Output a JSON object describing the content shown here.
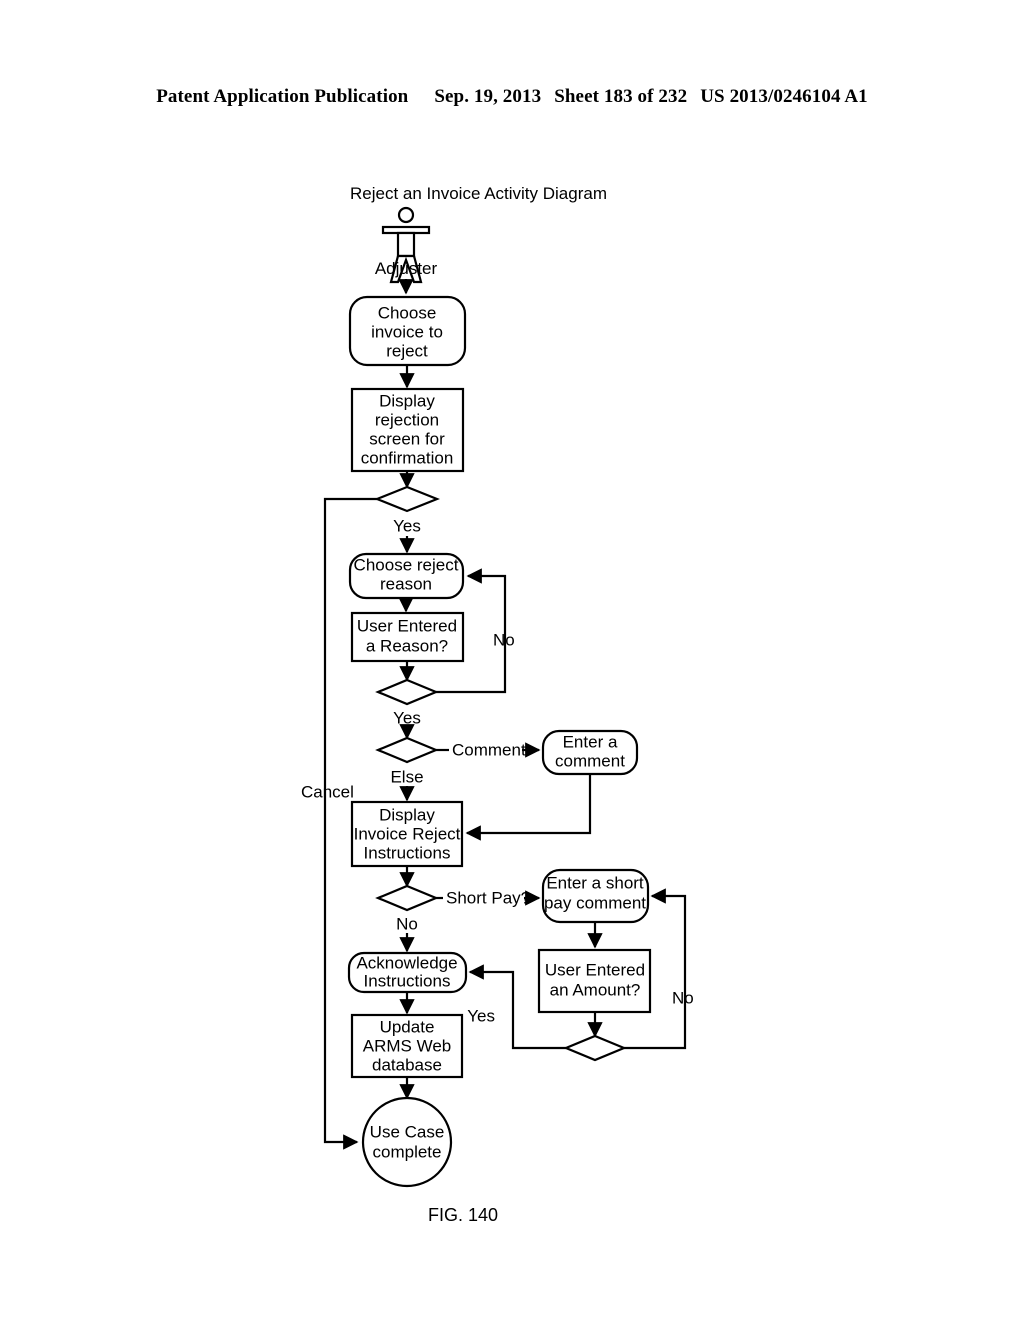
{
  "header": {
    "publication": "Patent Application Publication",
    "date": "Sep. 19, 2013",
    "sheet": "Sheet 183 of 232",
    "patent_number": "US 2013/0246104 A1"
  },
  "figure": {
    "caption": "FIG. 140",
    "title": "Reject an Invoice Activity Diagram",
    "actor": "Adjuster"
  },
  "nodes": {
    "choose_invoice": "Choose invoice to reject",
    "choose_invoice_l1": "Choose",
    "choose_invoice_l2": "invoice to",
    "choose_invoice_l3": "reject",
    "display_rejection_l1": "Display",
    "display_rejection_l2": "rejection",
    "display_rejection_l3": "screen for",
    "display_rejection_l4": "confirmation",
    "choose_reason_l1": "Choose reject",
    "choose_reason_l2": "reason",
    "user_reason_l1": "User Entered",
    "user_reason_l2": "a Reason?",
    "enter_comment_l1": "Enter a",
    "enter_comment_l2": "comment",
    "display_instructions_l1": "Display",
    "display_instructions_l2": "Invoice Reject",
    "display_instructions_l3": "Instructions",
    "short_pay_comment_l1": "Enter a short",
    "short_pay_comment_l2": "pay comment",
    "user_amount_l1": "User Entered",
    "user_amount_l2": "an Amount?",
    "acknowledge_l1": "Acknowledge",
    "acknowledge_l2": "Instructions",
    "update_db_l1": "Update",
    "update_db_l2": "ARMS Web",
    "update_db_l3": "database",
    "use_case_complete_l1": "Use Case",
    "use_case_complete_l2": "complete"
  },
  "edge_labels": {
    "confirm_yes": "Yes",
    "cancel": "Cancel",
    "reason_no": "No",
    "reason_yes": "Yes",
    "comment": "Comment",
    "else": "Else",
    "short_pay": "Short Pay?",
    "short_pay_no": "No",
    "amount_no": "No",
    "amount_yes": "Yes"
  },
  "chart_data": {
    "type": "diagram",
    "title": "Reject an Invoice Activity Diagram",
    "diagram_kind": "UML activity diagram",
    "actors": [
      "Adjuster"
    ],
    "nodes": [
      {
        "id": "adjuster",
        "label": "Adjuster",
        "shape": "actor"
      },
      {
        "id": "choose_invoice",
        "label": "Choose invoice to reject",
        "shape": "rounded-rect"
      },
      {
        "id": "display_rejection",
        "label": "Display rejection screen for confirmation",
        "shape": "rect"
      },
      {
        "id": "confirm_decision",
        "label": "",
        "shape": "diamond"
      },
      {
        "id": "choose_reason",
        "label": "Choose reject reason",
        "shape": "rounded-rect"
      },
      {
        "id": "user_reason",
        "label": "User Entered a Reason?",
        "shape": "rect"
      },
      {
        "id": "reason_decision",
        "label": "",
        "shape": "diamond"
      },
      {
        "id": "comment_decision",
        "label": "",
        "shape": "diamond"
      },
      {
        "id": "enter_comment",
        "label": "Enter a comment",
        "shape": "rounded-rect"
      },
      {
        "id": "display_instructions",
        "label": "Display Invoice Reject Instructions",
        "shape": "rect"
      },
      {
        "id": "short_pay_decision",
        "label": "",
        "shape": "diamond"
      },
      {
        "id": "short_pay_comment",
        "label": "Enter a short pay comment",
        "shape": "rounded-rect"
      },
      {
        "id": "user_amount",
        "label": "User Entered an Amount?",
        "shape": "rect"
      },
      {
        "id": "amount_decision",
        "label": "",
        "shape": "diamond"
      },
      {
        "id": "acknowledge",
        "label": "Acknowledge Instructions",
        "shape": "rounded-rect"
      },
      {
        "id": "update_db",
        "label": "Update ARMS Web database",
        "shape": "rect"
      },
      {
        "id": "use_case_complete",
        "label": "Use Case complete",
        "shape": "circle"
      }
    ],
    "edges": [
      {
        "from": "adjuster",
        "to": "choose_invoice",
        "label": ""
      },
      {
        "from": "choose_invoice",
        "to": "display_rejection",
        "label": ""
      },
      {
        "from": "display_rejection",
        "to": "confirm_decision",
        "label": ""
      },
      {
        "from": "confirm_decision",
        "to": "choose_reason",
        "label": "Yes"
      },
      {
        "from": "confirm_decision",
        "to": "use_case_complete",
        "label": "Cancel"
      },
      {
        "from": "choose_reason",
        "to": "user_reason",
        "label": ""
      },
      {
        "from": "user_reason",
        "to": "reason_decision",
        "label": ""
      },
      {
        "from": "reason_decision",
        "to": "choose_reason",
        "label": "No"
      },
      {
        "from": "reason_decision",
        "to": "comment_decision",
        "label": "Yes"
      },
      {
        "from": "comment_decision",
        "to": "enter_comment",
        "label": "Comment"
      },
      {
        "from": "comment_decision",
        "to": "display_instructions",
        "label": "Else"
      },
      {
        "from": "enter_comment",
        "to": "display_instructions",
        "label": ""
      },
      {
        "from": "display_instructions",
        "to": "short_pay_decision",
        "label": ""
      },
      {
        "from": "short_pay_decision",
        "to": "short_pay_comment",
        "label": "Short Pay?"
      },
      {
        "from": "short_pay_decision",
        "to": "acknowledge",
        "label": "No"
      },
      {
        "from": "short_pay_comment",
        "to": "user_amount",
        "label": ""
      },
      {
        "from": "user_amount",
        "to": "amount_decision",
        "label": ""
      },
      {
        "from": "amount_decision",
        "to": "short_pay_comment",
        "label": "No"
      },
      {
        "from": "amount_decision",
        "to": "acknowledge",
        "label": "Yes"
      },
      {
        "from": "acknowledge",
        "to": "update_db",
        "label": ""
      },
      {
        "from": "update_db",
        "to": "use_case_complete",
        "label": ""
      }
    ]
  }
}
